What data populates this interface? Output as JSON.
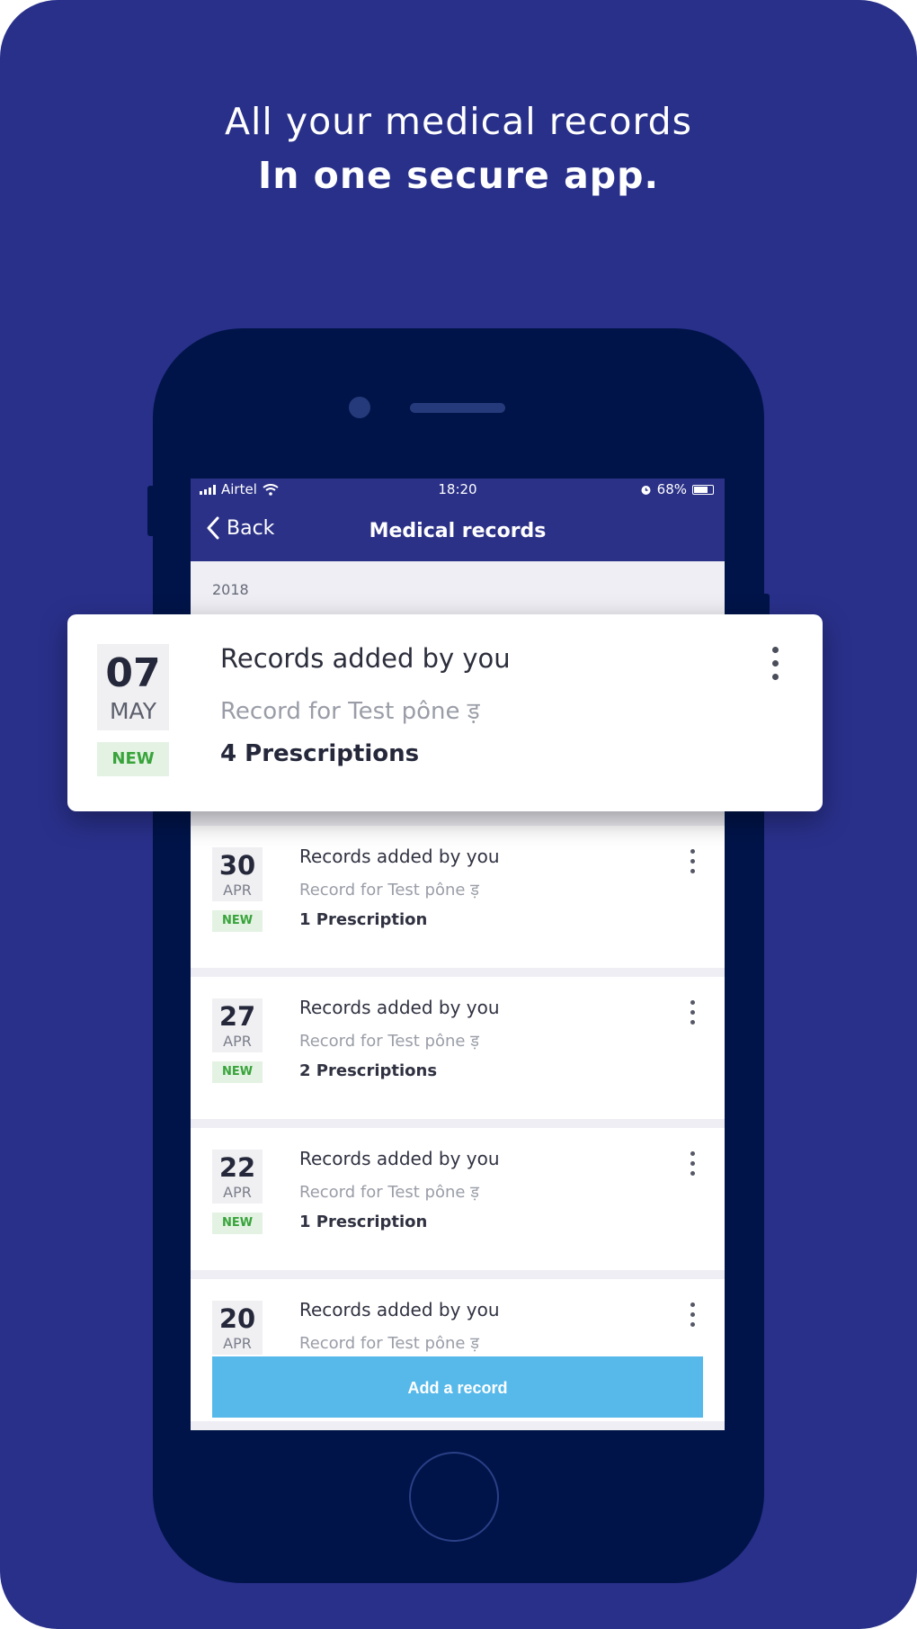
{
  "headline": {
    "line1": "All your medical records",
    "line2": "In one secure app."
  },
  "status_bar": {
    "carrier": "Airtel",
    "time": "18:20",
    "battery": "68%",
    "icons": [
      "signal-icon",
      "wifi-icon",
      "alarm-icon",
      "battery-icon"
    ]
  },
  "nav": {
    "back_label": "Back",
    "title": "Medical records"
  },
  "year_label": "2018",
  "featured_record": {
    "day": "07",
    "month": "MAY",
    "badge": "NEW",
    "title": "Records added by you",
    "subtitle": "Record for Test pône ड़",
    "count": "4 Prescriptions"
  },
  "records": [
    {
      "day": "30",
      "month": "APR",
      "badge": "NEW",
      "title": "Records added by you",
      "subtitle": "Record for Test pône ड़",
      "count": "1 Prescription"
    },
    {
      "day": "27",
      "month": "APR",
      "badge": "NEW",
      "title": "Records added by you",
      "subtitle": "Record for Test pône ड़",
      "count": "2 Prescriptions"
    },
    {
      "day": "22",
      "month": "APR",
      "badge": "NEW",
      "title": "Records added by you",
      "subtitle": "Record for Test pône ड़",
      "count": "1 Prescription"
    },
    {
      "day": "20",
      "month": "APR",
      "badge": "",
      "title": "Records added by you",
      "subtitle": "Record for Test pône ड़",
      "count": ""
    }
  ],
  "add_button_label": "Add a record",
  "colors": {
    "background": "#29308a",
    "phone_body": "#001449",
    "app_bar": "#2b3187",
    "button": "#57b9ea",
    "badge_text": "#38a43a"
  }
}
